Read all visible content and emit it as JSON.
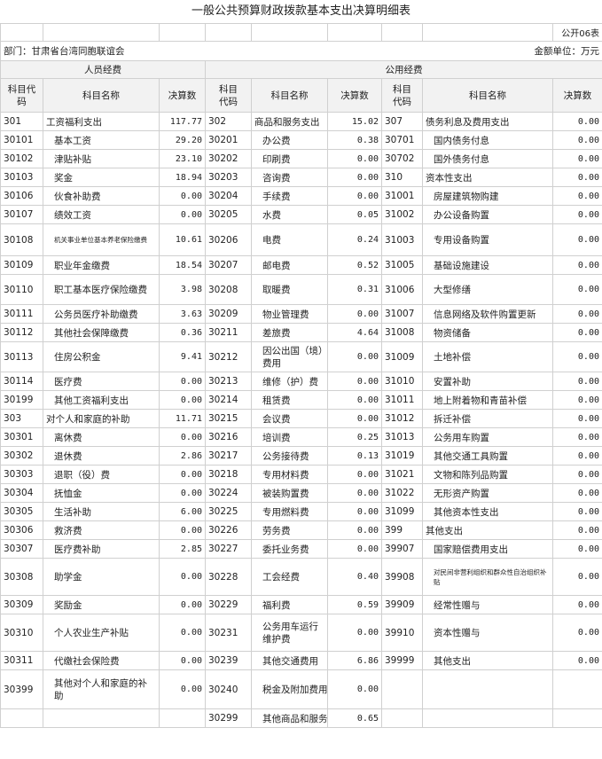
{
  "title": "一般公共预算财政拨款基本支出决算明细表",
  "table_code": "公开06表",
  "department": "部门：甘肃省台湾同胞联谊会",
  "unit": "金额单位：万元",
  "sections": {
    "personnel": "人员经费",
    "public": "公用经费"
  },
  "headers": {
    "code": "科目代码",
    "code_split": "科目\n代码",
    "name": "科目名称",
    "amount": "决算数"
  },
  "rows": [
    {
      "c1": "301",
      "n1": "工资福利支出",
      "a1": "117.77",
      "c2": "302",
      "n2": "商品和服务支出",
      "a2": "15.02",
      "c3": "307",
      "n3": "债务利息及费用支出",
      "a3": "0.00"
    },
    {
      "c1": "30101",
      "n1": "基本工资",
      "a1": "29.20",
      "c2": "30201",
      "n2": "办公费",
      "a2": "0.38",
      "c3": "30701",
      "n3": "国内债务付息",
      "a3": "0.00"
    },
    {
      "c1": "30102",
      "n1": "津贴补贴",
      "a1": "23.10",
      "c2": "30202",
      "n2": "印刷费",
      "a2": "0.00",
      "c3": "30702",
      "n3": "国外债务付息",
      "a3": "0.00"
    },
    {
      "c1": "30103",
      "n1": "奖金",
      "a1": "18.94",
      "c2": "30203",
      "n2": "咨询费",
      "a2": "0.00",
      "c3": "310",
      "n3": "资本性支出",
      "a3": "0.00"
    },
    {
      "c1": "30106",
      "n1": "伙食补助费",
      "a1": "0.00",
      "c2": "30204",
      "n2": "手续费",
      "a2": "0.00",
      "c3": "31001",
      "n3": "房屋建筑物购建",
      "a3": "0.00"
    },
    {
      "c1": "30107",
      "n1": "绩效工资",
      "a1": "0.00",
      "c2": "30205",
      "n2": "水费",
      "a2": "0.05",
      "c3": "31002",
      "n3": "办公设备购置",
      "a3": "0.00"
    },
    {
      "c1": "30108",
      "n1": "机关事业单位基本养老保险缴费",
      "a1": "10.61",
      "c2": "30206",
      "n2": "电费",
      "a2": "0.24",
      "c3": "31003",
      "n3": "专用设备购置",
      "a3": "0.00"
    },
    {
      "c1": "30109",
      "n1": "职业年金缴费",
      "a1": "18.54",
      "c2": "30207",
      "n2": "邮电费",
      "a2": "0.52",
      "c3": "31005",
      "n3": "基础设施建设",
      "a3": "0.00"
    },
    {
      "c1": "30110",
      "n1": "职工基本医疗保险缴费",
      "a1": "3.98",
      "c2": "30208",
      "n2": "取暖费",
      "a2": "0.31",
      "c3": "31006",
      "n3": "大型修缮",
      "a3": "0.00"
    },
    {
      "c1": "30111",
      "n1": "公务员医疗补助缴费",
      "a1": "3.63",
      "c2": "30209",
      "n2": "物业管理费",
      "a2": "0.00",
      "c3": "31007",
      "n3": "信息网络及软件购置更新",
      "a3": "0.00"
    },
    {
      "c1": "30112",
      "n1": "其他社会保障缴费",
      "a1": "0.36",
      "c2": "30211",
      "n2": "差旅费",
      "a2": "4.64",
      "c3": "31008",
      "n3": "物资储备",
      "a3": "0.00"
    },
    {
      "c1": "30113",
      "n1": "住房公积金",
      "a1": "9.41",
      "c2": "30212",
      "n2": "因公出国（境）费用",
      "a2": "0.00",
      "c3": "31009",
      "n3": "土地补偿",
      "a3": "0.00"
    },
    {
      "c1": "30114",
      "n1": "医疗费",
      "a1": "0.00",
      "c2": "30213",
      "n2": "维修（护）费",
      "a2": "0.00",
      "c3": "31010",
      "n3": "安置补助",
      "a3": "0.00"
    },
    {
      "c1": "30199",
      "n1": "其他工资福利支出",
      "a1": "0.00",
      "c2": "30214",
      "n2": "租赁费",
      "a2": "0.00",
      "c3": "31011",
      "n3": "地上附着物和青苗补偿",
      "a3": "0.00"
    },
    {
      "c1": "303",
      "n1": "对个人和家庭的补助",
      "a1": "11.71",
      "c2": "30215",
      "n2": "会议费",
      "a2": "0.00",
      "c3": "31012",
      "n3": "拆迁补偿",
      "a3": "0.00"
    },
    {
      "c1": "30301",
      "n1": "离休费",
      "a1": "0.00",
      "c2": "30216",
      "n2": "培训费",
      "a2": "0.25",
      "c3": "31013",
      "n3": "公务用车购置",
      "a3": "0.00"
    },
    {
      "c1": "30302",
      "n1": "退休费",
      "a1": "2.86",
      "c2": "30217",
      "n2": "公务接待费",
      "a2": "0.13",
      "c3": "31019",
      "n3": "其他交通工具购置",
      "a3": "0.00"
    },
    {
      "c1": "30303",
      "n1": "退职（役）费",
      "a1": "0.00",
      "c2": "30218",
      "n2": "专用材料费",
      "a2": "0.00",
      "c3": "31021",
      "n3": "文物和陈列品购置",
      "a3": "0.00"
    },
    {
      "c1": "30304",
      "n1": "抚恤金",
      "a1": "0.00",
      "c2": "30224",
      "n2": "被装购置费",
      "a2": "0.00",
      "c3": "31022",
      "n3": "无形资产购置",
      "a3": "0.00"
    },
    {
      "c1": "30305",
      "n1": "生活补助",
      "a1": "6.00",
      "c2": "30225",
      "n2": "专用燃料费",
      "a2": "0.00",
      "c3": "31099",
      "n3": "其他资本性支出",
      "a3": "0.00"
    },
    {
      "c1": "30306",
      "n1": "救济费",
      "a1": "0.00",
      "c2": "30226",
      "n2": "劳务费",
      "a2": "0.00",
      "c3": "399",
      "n3": "其他支出",
      "a3": "0.00"
    },
    {
      "c1": "30307",
      "n1": "医疗费补助",
      "a1": "2.85",
      "c2": "30227",
      "n2": "委托业务费",
      "a2": "0.00",
      "c3": "39907",
      "n3": "国家赔偿费用支出",
      "a3": "0.00"
    },
    {
      "c1": "30308",
      "n1": "助学金",
      "a1": "0.00",
      "c2": "30228",
      "n2": "工会经费",
      "a2": "0.40",
      "c3": "39908",
      "n3": "对民间非营利组织和群众性自治组织补贴",
      "a3": "0.00"
    },
    {
      "c1": "30309",
      "n1": "奖励金",
      "a1": "0.00",
      "c2": "30229",
      "n2": "福利费",
      "a2": "0.59",
      "c3": "39909",
      "n3": "经常性赠与",
      "a3": "0.00"
    },
    {
      "c1": "30310",
      "n1": "个人农业生产补贴",
      "a1": "0.00",
      "c2": "30231",
      "n2": "公务用车运行维护费",
      "a2": "0.00",
      "c3": "39910",
      "n3": "资本性赠与",
      "a3": "0.00"
    },
    {
      "c1": "30311",
      "n1": "代缴社会保险费",
      "a1": "0.00",
      "c2": "30239",
      "n2": "其他交通费用",
      "a2": "6.86",
      "c3": "39999",
      "n3": "其他支出",
      "a3": "0.00"
    },
    {
      "c1": "30399",
      "n1": "其他对个人和家庭的补助",
      "a1": "0.00",
      "c2": "30240",
      "n2": "税金及附加费用",
      "a2": "0.00",
      "c3": "",
      "n3": "",
      "a3": ""
    },
    {
      "c1": "",
      "n1": "",
      "a1": "",
      "c2": "30299",
      "n2": "其他商品和服务",
      "a2": "0.65",
      "c3": "",
      "n3": "",
      "a3": ""
    }
  ]
}
